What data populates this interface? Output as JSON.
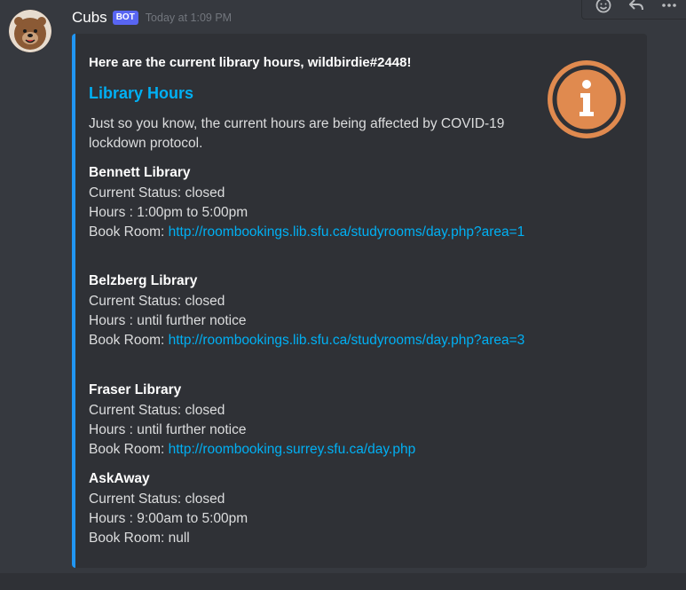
{
  "message": {
    "username": "Cubs",
    "bot_tag": "BOT",
    "timestamp": "Today at 1:09 PM"
  },
  "embed": {
    "author": "Here are the current library hours, wildbirdie#2448!",
    "title": "Library Hours",
    "description": "Just so you know, the current hours are being affected by COVID-19 lockdown protocol.",
    "accent_color": "#2196f3",
    "thumbnail_icon": "info-icon",
    "fields": [
      {
        "name": "Bennett Library",
        "status": "Current Status: closed",
        "hours": "Hours : 1:00pm to 5:00pm",
        "book_label": "Book Room:",
        "book_link": "http://roombookings.lib.sfu.ca/studyrooms/day.php?area=1"
      },
      {
        "name": "Belzberg Library",
        "status": "Current Status: closed",
        "hours": "Hours : until further notice",
        "book_label": "Book Room:",
        "book_link": "http://roombookings.lib.sfu.ca/studyrooms/day.php?area=3"
      },
      {
        "name": "Fraser Library",
        "status": "Current Status: closed",
        "hours": "Hours : until further notice",
        "book_label": "Book Room:",
        "book_link": "http://roombooking.surrey.sfu.ca/day.php"
      },
      {
        "name": "AskAway",
        "status": "Current Status: closed",
        "hours": "Hours : 9:00am to 5:00pm",
        "book_label": "Book Room:",
        "book_text": "null"
      }
    ]
  },
  "toolbar": {
    "icons": [
      "add-reaction-icon",
      "reply-icon",
      "more-icon"
    ]
  }
}
